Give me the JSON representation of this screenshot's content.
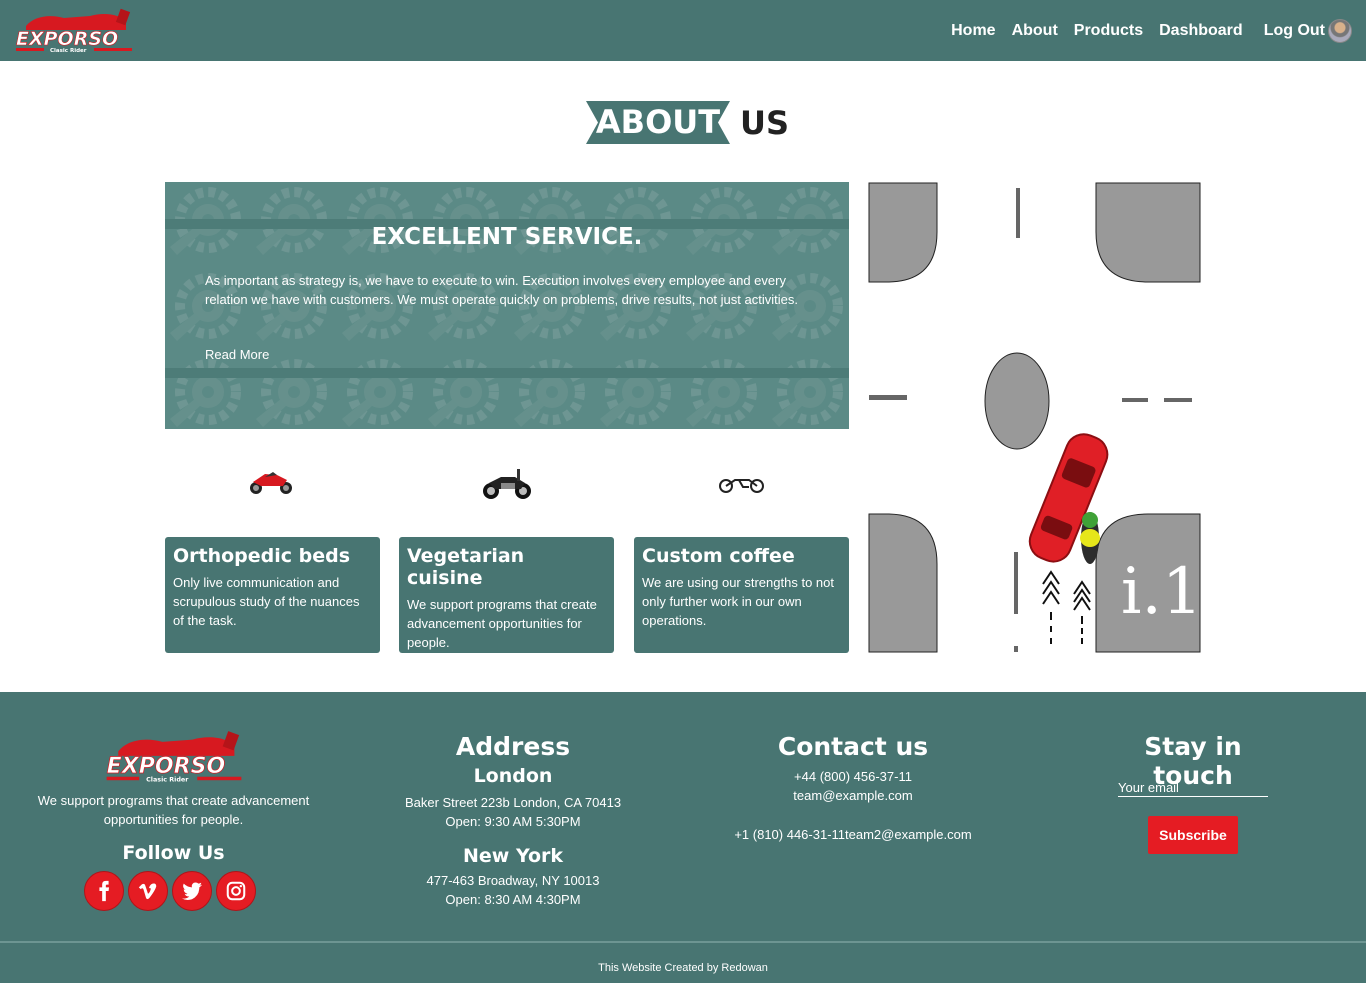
{
  "nav": {
    "logo_text": "EXPORSO",
    "logo_sub": "Clasic Rider",
    "links": [
      "Home",
      "About",
      "Products",
      "Dashboard"
    ],
    "logout": "Log Out"
  },
  "heading": {
    "highlight": "ABOUT",
    "rest": "US"
  },
  "banner": {
    "title": "EXCELLENT SERVICE.",
    "text": "As important as strategy is, we have to execute to win. Execution involves every employee and every relation we have with customers. We must operate quickly on problems, drive results, not just activities.",
    "link": "Read More"
  },
  "cards": [
    {
      "title": "Orthopedic beds",
      "text": "Only live communication and scrupulous study of the nuances of the task."
    },
    {
      "title": "Vegetarian cuisine",
      "text": "We support programs that create advancement opportunities for people."
    },
    {
      "title": "Custom coffee",
      "text": "We are using our strengths to not only further work in our own operations."
    }
  ],
  "illustration": {
    "sign_text": "i.1"
  },
  "footer": {
    "logo_text": "EXPORSO",
    "logo_sub": "Clasic Rider",
    "tagline": "We support programs that create advancement opportunities for people.",
    "follow": "Follow Us",
    "socials": [
      "facebook-icon",
      "vimeo-icon",
      "twitter-icon",
      "instagram-icon"
    ],
    "address": {
      "title": "Address",
      "city1": "London",
      "addr1": "Baker Street 223b London, CA 70413",
      "hours1": "Open: 9:30 AM 5:30PM",
      "city2": "New York",
      "addr2": "477-463 Broadway, NY 10013",
      "hours2": "Open: 8:30 AM 4:30PM"
    },
    "contact": {
      "title": "Contact us",
      "phone1": "+44 (800) 456-37-11",
      "email1": "team@example.com",
      "line2": "+1 (810) 446-31-11team2@example.com"
    },
    "newsletter": {
      "title": "Stay in touch",
      "placeholder": "Your email",
      "button": "Subscribe"
    },
    "credit": "This Website Created by Redowan"
  },
  "colors": {
    "primary": "#487572",
    "accent": "#e51c23"
  }
}
